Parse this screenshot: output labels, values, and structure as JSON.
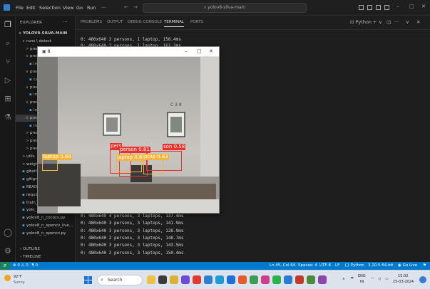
{
  "titlebar": {
    "menus": [
      "File",
      "Edit",
      "Selection",
      "View",
      "Go",
      "Run",
      "···"
    ],
    "search_text": "yolov8-silva-main",
    "window_controls": [
      "–",
      "□",
      "✕"
    ]
  },
  "activity_icons": [
    "files-icon",
    "search-icon",
    "source-control-icon",
    "run-debug-icon",
    "extensions-icon",
    "testing-icon",
    "account-icon",
    "settings-gear-icon"
  ],
  "sidebar": {
    "header": "EXPLORER",
    "more": "···",
    "tree": [
      {
        "label": "YOLOV8-SILVA-MAIN",
        "chev": "∨",
        "level": 0,
        "bold": true
      },
      {
        "label": "runs \\ detect",
        "chev": "∨",
        "level": 1
      },
      {
        "label": "prec",
        "chev": ">",
        "level": 2
      },
      {
        "label": "prec",
        "chev": "∨",
        "level": 2
      },
      {
        "label": "imag",
        "chev": "",
        "level": 3,
        "file": true
      },
      {
        "label": "prec",
        "chev": "∨",
        "level": 2
      },
      {
        "label": "cat",
        "chev": "",
        "level": 3,
        "file": true
      },
      {
        "label": "prec",
        "chev": "∨",
        "level": 2
      },
      {
        "label": "ima",
        "chev": "",
        "level": 3,
        "file": true
      },
      {
        "label": "prec",
        "chev": "∨",
        "level": 2
      },
      {
        "label": "ima",
        "chev": "",
        "level": 3,
        "file": true
      },
      {
        "label": "prec",
        "chev": "∨",
        "level": 2,
        "selected": true
      },
      {
        "label": "ima",
        "chev": "",
        "level": 3,
        "file": true
      },
      {
        "label": "prec",
        "chev": ">",
        "level": 2
      },
      {
        "label": "prec",
        "chev": ">",
        "level": 2
      },
      {
        "label": "prec",
        "chev": ">",
        "level": 2
      },
      {
        "label": "utils",
        "chev": ">",
        "level": 1
      },
      {
        "label": "weigh",
        "chev": ">",
        "level": 1
      },
      {
        "label": "gitatt",
        "chev": "",
        "level": 1,
        "file": true
      },
      {
        "label": "gitign",
        "chev": "",
        "level": 1,
        "file": true
      },
      {
        "label": "READ",
        "chev": "",
        "level": 1,
        "file": true
      },
      {
        "label": "requir",
        "chev": "",
        "level": 1,
        "file": true
      },
      {
        "label": "train_",
        "chev": "",
        "level": 1,
        "file": true
      },
      {
        "label": "yolo_",
        "chev": "",
        "level": 1,
        "file": true
      },
      {
        "label": "yolov8_n_cococs.py",
        "chev": "",
        "level": 1,
        "file": true
      },
      {
        "label": "yolov8_n_opencv_live...",
        "chev": "",
        "level": 1,
        "file": true
      },
      {
        "label": "yolov8_n_opencv.py",
        "chev": "",
        "level": 1,
        "file": true
      }
    ],
    "outline": "OUTLINE",
    "timeline": "TIMELINE"
  },
  "panel": {
    "tabs": [
      "PROBLEMS",
      "OUTPUT",
      "DEBUG CONSOLE",
      "TERMINAL",
      "PORTS"
    ],
    "active_tab": "TERMINAL",
    "shell": "Python",
    "controls": [
      "+",
      "∨",
      "◫",
      "···",
      "∨",
      "✕"
    ]
  },
  "terminal": {
    "top_lines": [
      "0: 480x640 2 persons, 1 laptop, 158.4ms",
      "0: 480x640 2 persons, 1 laptop, 161.3ms"
    ],
    "bottom_lines": [
      "0: 480x640 4 persons, 3 laptops, 137.4ms",
      "0: 480x640 3 persons, 3 laptops, 141.9ms",
      "0: 480x640 3 persons, 3 laptops, 128.9ms",
      "0: 480x640 2 persons, 3 laptops, 148.7ms",
      "0: 480x640 3 persons, 3 laptops, 143.5ms",
      "0: 480x640 2 persons, 3 laptops, 150.4ms"
    ]
  },
  "camera_window": {
    "title": "8",
    "controls": [
      "–",
      "□",
      "✕"
    ],
    "wall_text": "C 3 8",
    "detections": [
      {
        "label": "laptop 0.66",
        "color": "#f5b53c"
      },
      {
        "label": "pers",
        "color": "#e8322d"
      },
      {
        "label": "person 0.81",
        "color": "#e8322d"
      },
      {
        "label": "son 0.58",
        "color": "#e8322d"
      },
      {
        "label": "laptop 0.68",
        "color": "#f5b53c"
      },
      {
        "label": "ptop 0.83",
        "color": "#f5b53c"
      }
    ]
  },
  "statusbar": {
    "remote": "⪞",
    "left": "⊗ 0 ⚠ 0   `¶ 0",
    "right": [
      "Ln 45, Col 64",
      "Spaces: 4",
      "UTF-8",
      "LF",
      "{} Python",
      "3.10.5 64-bit",
      "Go Live",
      "⚑"
    ]
  },
  "taskbar": {
    "weather_temp": "92°F",
    "weather_desc": "Sunny",
    "search_label": "Search",
    "lang": "ENG",
    "lang_sub": "IN",
    "time": "15:02",
    "date": "25-03-2024"
  },
  "colors": {
    "status_blue": "#007acc",
    "detect_red": "#e8322d",
    "detect_orange": "#f5b53c"
  }
}
